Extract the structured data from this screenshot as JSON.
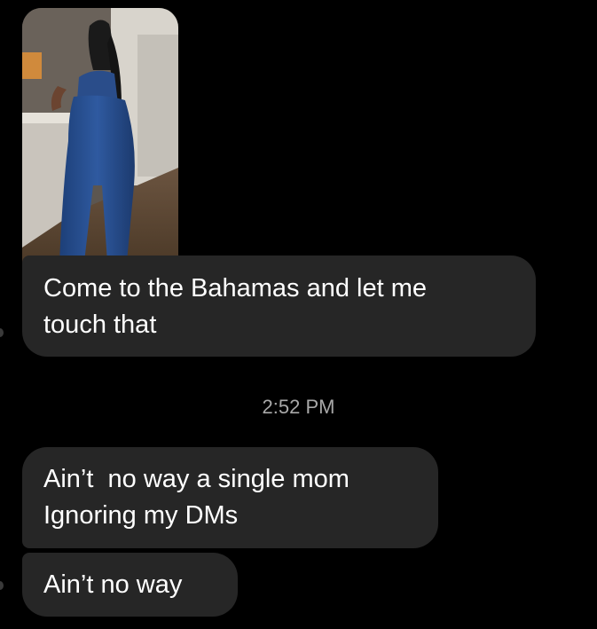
{
  "messages": [
    {
      "type": "image",
      "icon": "photo-of-person-in-kitchen"
    },
    {
      "type": "text",
      "lines": [
        "Come to the Bahamas and let me",
        "touch that"
      ]
    },
    {
      "type": "text",
      "lines": [
        "Ain’t  no way a single mom",
        "Ignoring my DMs"
      ]
    },
    {
      "type": "text",
      "lines": [
        "Ain’t no way"
      ]
    }
  ],
  "timestamp": "2:52 PM",
  "colors": {
    "background": "#000000",
    "bubble": "#262626",
    "text": "#ffffff",
    "timestamp": "#a8a8a8"
  }
}
